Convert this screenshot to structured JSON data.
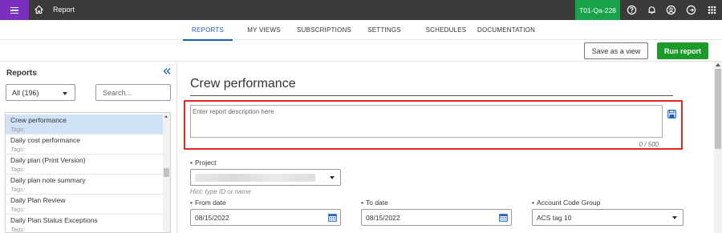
{
  "topbar": {
    "title": "Report",
    "environment": "T01-Qa-228",
    "icons": [
      "menu-icon",
      "home-icon",
      "help-icon",
      "bell-icon",
      "user-icon",
      "logout-icon",
      "apps-icon"
    ],
    "accent": "#7b2fbf",
    "env_color": "#1aa34a"
  },
  "tabs": [
    {
      "label": "REPORTS",
      "active": true
    },
    {
      "label": "MY VIEWS"
    },
    {
      "label": "SUBSCRIPTIONS"
    },
    {
      "label": "SETTINGS"
    },
    {
      "label": "SCHEDULES"
    },
    {
      "label": "DOCUMENTATION"
    }
  ],
  "actions": {
    "save_view": "Save as a view",
    "run_report": "Run report",
    "run_color": "#1e9a2a"
  },
  "sidebar": {
    "title": "Reports",
    "filter_value": "All (196)",
    "search_placeholder": "Search...",
    "items": [
      {
        "name": "Crew performance",
        "tags": "Tags:"
      },
      {
        "name": "Daily cost performance",
        "tags": "Tags:"
      },
      {
        "name": "Daily plan (Print Version)",
        "tags": "Tags:"
      },
      {
        "name": "Daily plan note summary",
        "tags": "Tags:"
      },
      {
        "name": "Daily Plan Review",
        "tags": "Tags:"
      },
      {
        "name": "Daily Plan Status Exceptions",
        "tags": "Tags:"
      }
    ]
  },
  "main": {
    "title": "Crew performance",
    "description_placeholder": "Enter report description here",
    "counter": "0 / 500",
    "project_label": "Project",
    "project_hint": "Hint: type ID or name",
    "from_label": "From date",
    "from_value": "08/15/2022",
    "to_label": "To date",
    "to_value": "08/15/2022",
    "acg_label": "Account Code Group",
    "acg_value": "ACS tag 10",
    "required_mark": "•"
  }
}
